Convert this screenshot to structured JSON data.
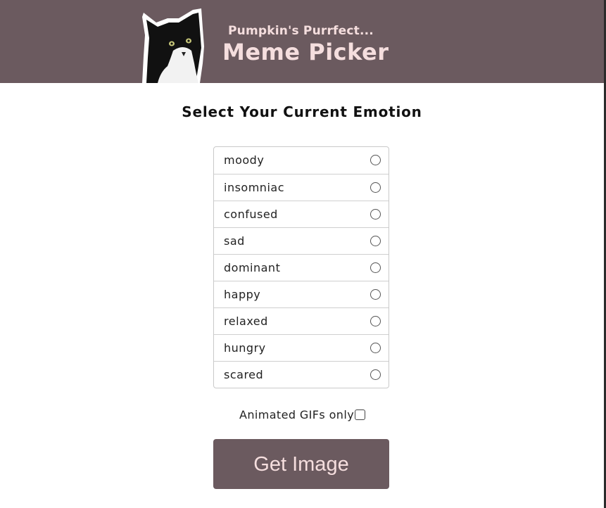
{
  "header": {
    "subtitle": "Pumpkin's Purrfect...",
    "title": "Meme Picker",
    "bg_color": "#6b5a5f",
    "text_color": "#f5dede"
  },
  "main": {
    "heading": "Select Your Current Emotion",
    "emotions": [
      {
        "label": "moody"
      },
      {
        "label": "insomniac"
      },
      {
        "label": "confused"
      },
      {
        "label": "sad"
      },
      {
        "label": "dominant"
      },
      {
        "label": "happy"
      },
      {
        "label": "relaxed"
      },
      {
        "label": "hungry"
      },
      {
        "label": "scared"
      }
    ],
    "gif_only_label": "Animated GIFs only",
    "gif_only_checked": false,
    "submit_label": "Get Image"
  }
}
